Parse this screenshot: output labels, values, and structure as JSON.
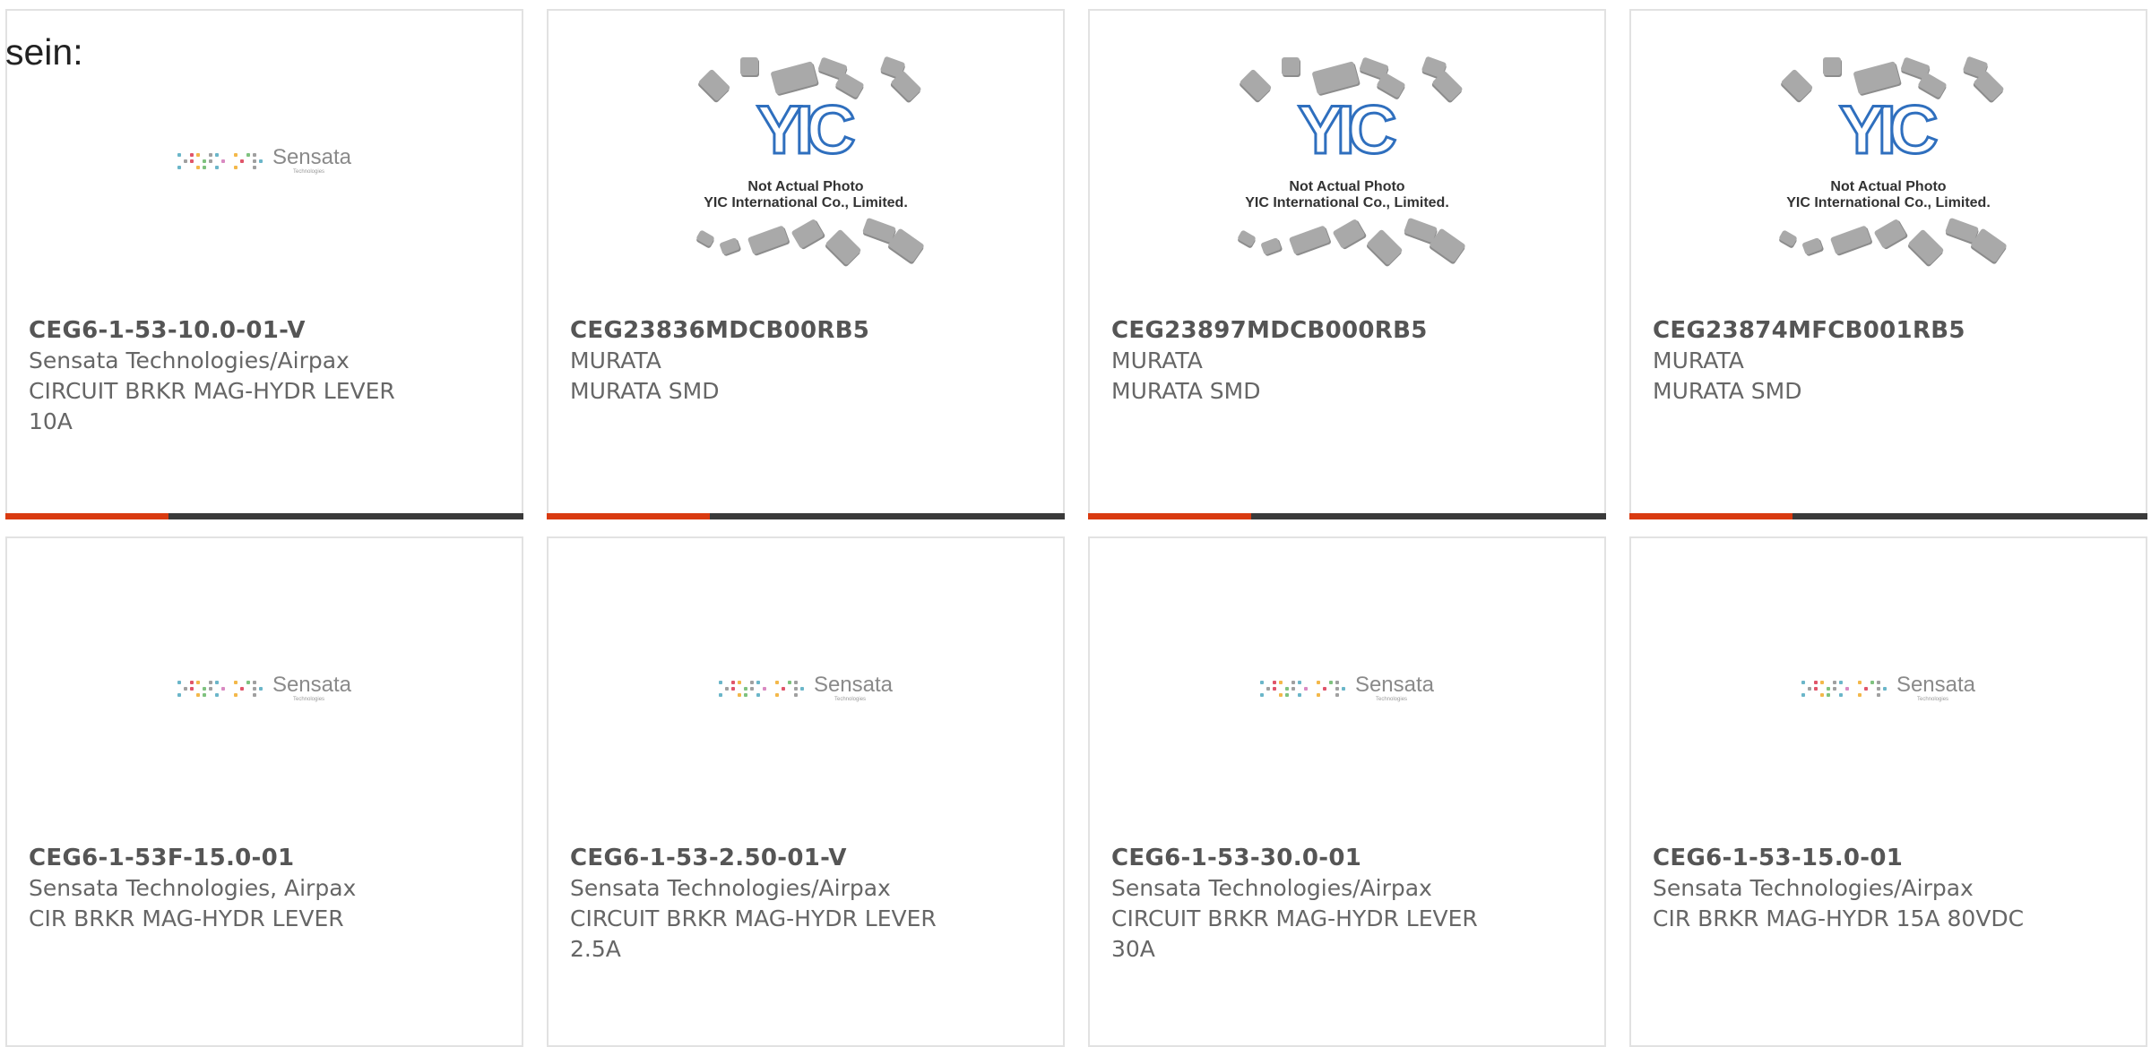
{
  "intro_text": "sein:",
  "colors": {
    "accent": "#d93a10",
    "bar": "#3a3a3a",
    "border": "#e2e2e2"
  },
  "placeholder": {
    "line1": "Not Actual Photo",
    "line2": "YIC International Co., Limited.",
    "logo": "YIC"
  },
  "sensata_logo": {
    "word": "Sensata",
    "sub": "Technologies"
  },
  "products": [
    {
      "part": "CEG6-1-53-10.0-01-V",
      "manufacturer": "Sensata Technologies/Airpax",
      "description": "CIRCUIT BRKR MAG-HYDR LEVER 10A",
      "image": "sensata-logo"
    },
    {
      "part": "CEG23836MDCB00RB5",
      "manufacturer": "MURATA",
      "description": "MURATA SMD",
      "image": "yic-placeholder"
    },
    {
      "part": "CEG23897MDCB000RB5",
      "manufacturer": "MURATA",
      "description": "MURATA SMD",
      "image": "yic-placeholder"
    },
    {
      "part": "CEG23874MFCB001RB5",
      "manufacturer": "MURATA",
      "description": "MURATA SMD",
      "image": "yic-placeholder"
    },
    {
      "part": "CEG6-1-53F-15.0-01",
      "manufacturer": "Sensata Technologies, Airpax",
      "description": "CIR BRKR MAG-HYDR LEVER",
      "image": "sensata-logo"
    },
    {
      "part": "CEG6-1-53-2.50-01-V",
      "manufacturer": "Sensata Technologies/Airpax",
      "description": "CIRCUIT BRKR MAG-HYDR LEVER 2.5A",
      "image": "sensata-logo"
    },
    {
      "part": "CEG6-1-53-30.0-01",
      "manufacturer": "Sensata Technologies/Airpax",
      "description": "CIRCUIT BRKR MAG-HYDR LEVER 30A",
      "image": "sensata-logo"
    },
    {
      "part": "CEG6-1-53-15.0-01",
      "manufacturer": "Sensata Technologies/Airpax",
      "description": "CIR BRKR MAG-HYDR 15A 80VDC",
      "image": "sensata-logo"
    }
  ]
}
